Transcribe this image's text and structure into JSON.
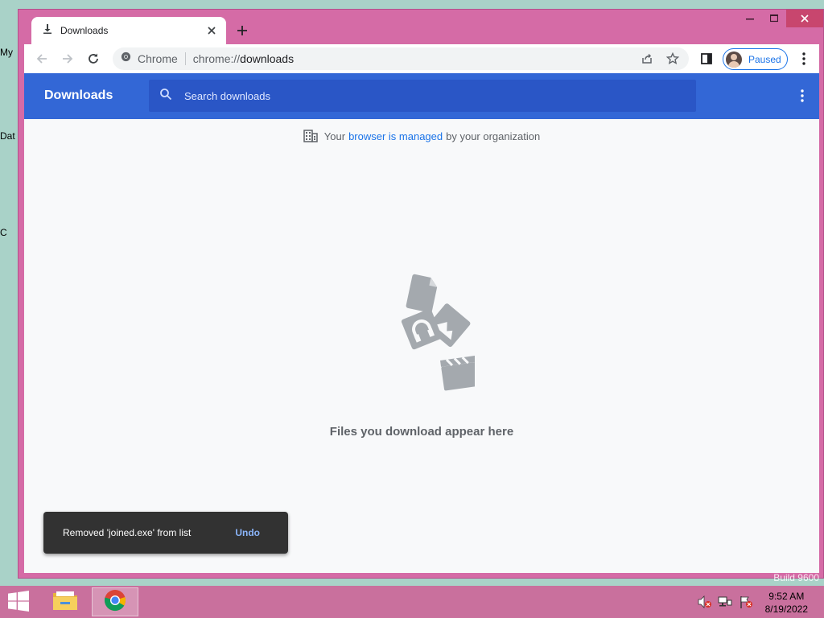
{
  "desktop": {
    "fragments": [
      "My",
      "Dat",
      "C"
    ]
  },
  "browser": {
    "tab": {
      "title": "Downloads",
      "icon": "download-icon"
    },
    "omnibox": {
      "chip": "Chrome",
      "url_scheme": "chrome://",
      "url_host": "downloads"
    },
    "profile": {
      "label": "Paused"
    }
  },
  "downloads_page": {
    "title": "Downloads",
    "search_placeholder": "Search downloads",
    "managed_prefix": "Your",
    "managed_link": "browser is managed",
    "managed_suffix": "by your organization",
    "empty_text": "Files you download appear here",
    "toast": {
      "message": "Removed 'joined.exe' from list",
      "action": "Undo"
    }
  },
  "watermark": "Build 9600",
  "taskbar": {
    "time": "9:52 AM",
    "date": "8/19/2022"
  },
  "colors": {
    "window_frame": "#d56ba6",
    "header_blue": "#3367d6",
    "search_blue": "#2a56c6",
    "link_blue": "#1a73e8",
    "toast_bg": "#323232",
    "taskbar": "#c9709d"
  }
}
